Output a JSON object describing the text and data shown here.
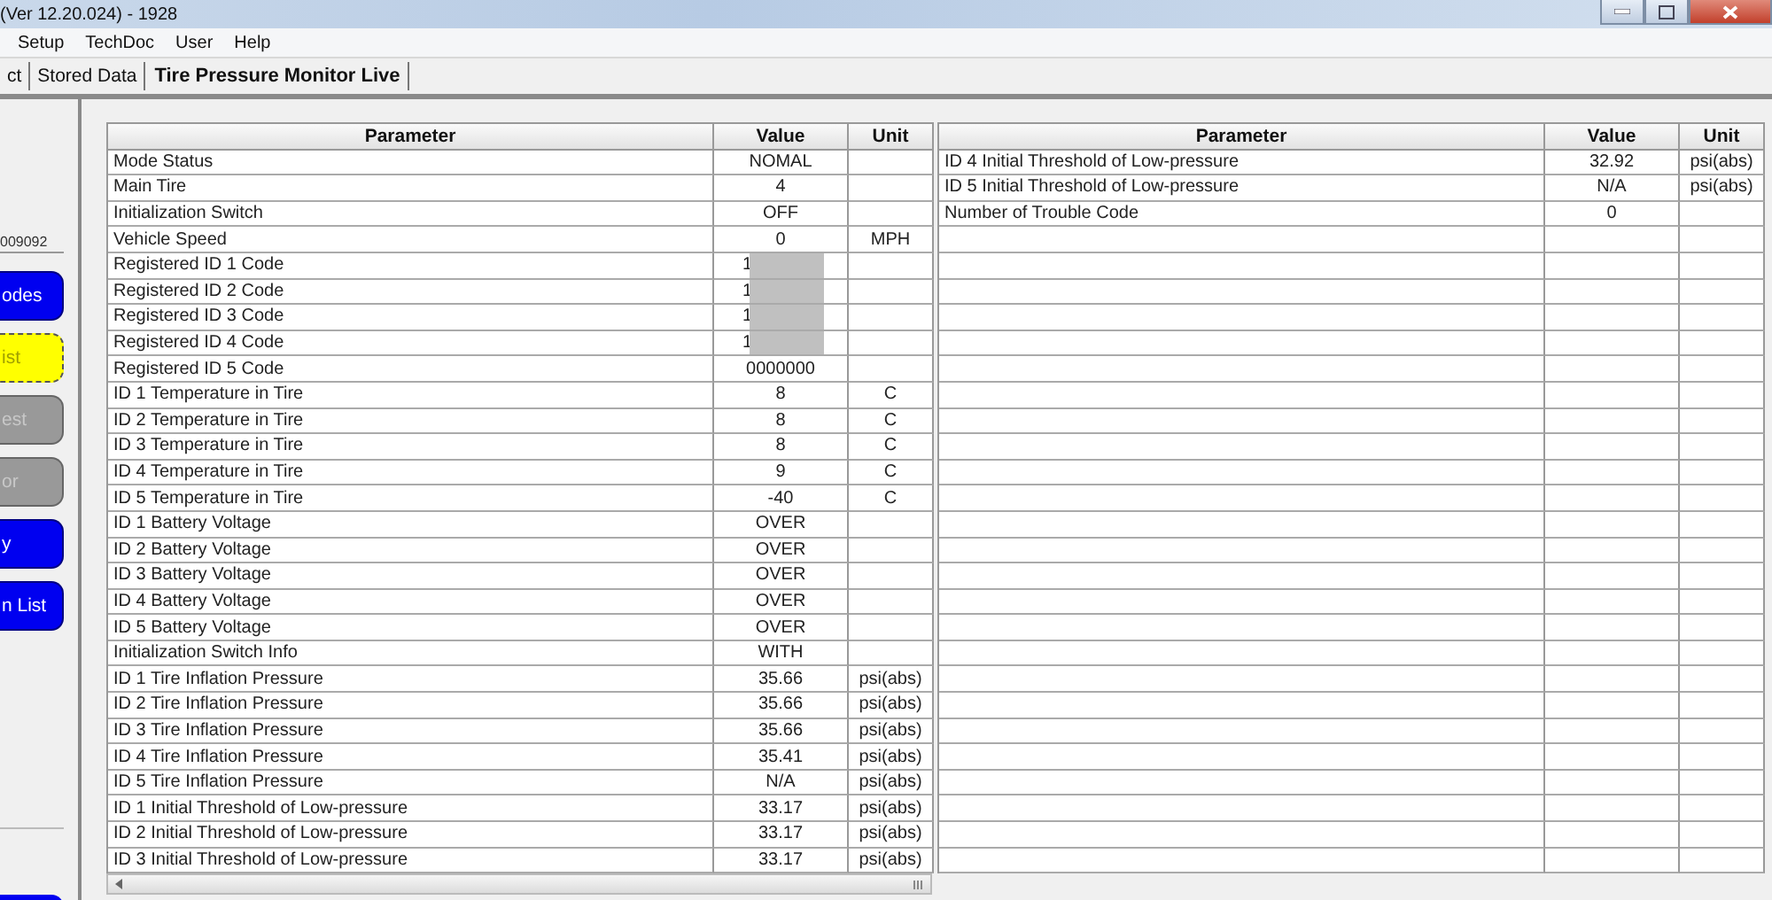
{
  "window": {
    "title": "(Ver 12.20.024) - 1928"
  },
  "menu": [
    "Setup",
    "TechDoc",
    "User",
    "Help"
  ],
  "tabs": [
    {
      "label": "ct",
      "selected": false
    },
    {
      "label": "Stored Data",
      "selected": false
    },
    {
      "label": "Tire Pressure Monitor Live",
      "selected": true
    }
  ],
  "sidebar": {
    "field_value": "009092",
    "buttons": [
      {
        "label": "odes",
        "kind": "blue"
      },
      {
        "label": "ist",
        "kind": "yellow"
      },
      {
        "label": "est",
        "kind": "disabled"
      },
      {
        "label": "or",
        "kind": "disabled"
      },
      {
        "label": "y",
        "kind": "blue"
      },
      {
        "label": "n List",
        "kind": "blue"
      }
    ]
  },
  "tables": [
    {
      "columns": [
        "Parameter",
        "Value",
        "Unit"
      ],
      "rows": [
        {
          "parameter": "Mode Status",
          "value": "NOMAL",
          "unit": ""
        },
        {
          "parameter": "Main Tire",
          "value": "4",
          "unit": ""
        },
        {
          "parameter": "Initialization Switch",
          "value": "OFF",
          "unit": ""
        },
        {
          "parameter": "Vehicle Speed",
          "value": "0",
          "unit": "MPH"
        },
        {
          "parameter": "Registered ID 1 Code",
          "value": "1",
          "unit": "",
          "redacted": true
        },
        {
          "parameter": "Registered ID 2 Code",
          "value": "1",
          "unit": "",
          "redacted": true
        },
        {
          "parameter": "Registered ID 3 Code",
          "value": "1",
          "unit": "",
          "redacted": true
        },
        {
          "parameter": "Registered ID 4 Code",
          "value": "1",
          "unit": "",
          "redacted": true
        },
        {
          "parameter": "Registered ID 5 Code",
          "value": "0000000",
          "unit": ""
        },
        {
          "parameter": "ID 1 Temperature in Tire",
          "value": "8",
          "unit": "C"
        },
        {
          "parameter": "ID 2 Temperature in Tire",
          "value": "8",
          "unit": "C"
        },
        {
          "parameter": "ID 3 Temperature in Tire",
          "value": "8",
          "unit": "C"
        },
        {
          "parameter": "ID 4 Temperature in Tire",
          "value": "9",
          "unit": "C"
        },
        {
          "parameter": "ID 5 Temperature in Tire",
          "value": "-40",
          "unit": "C"
        },
        {
          "parameter": "ID 1 Battery Voltage",
          "value": "OVER",
          "unit": ""
        },
        {
          "parameter": "ID 2 Battery Voltage",
          "value": "OVER",
          "unit": ""
        },
        {
          "parameter": "ID 3 Battery Voltage",
          "value": "OVER",
          "unit": ""
        },
        {
          "parameter": "ID 4 Battery Voltage",
          "value": "OVER",
          "unit": ""
        },
        {
          "parameter": "ID 5 Battery Voltage",
          "value": "OVER",
          "unit": ""
        },
        {
          "parameter": "Initialization Switch Info",
          "value": "WITH",
          "unit": ""
        },
        {
          "parameter": "ID 1 Tire Inflation Pressure",
          "value": "35.66",
          "unit": "psi(abs)"
        },
        {
          "parameter": "ID 2 Tire Inflation Pressure",
          "value": "35.66",
          "unit": "psi(abs)"
        },
        {
          "parameter": "ID 3 Tire Inflation Pressure",
          "value": "35.66",
          "unit": "psi(abs)"
        },
        {
          "parameter": "ID 4 Tire Inflation Pressure",
          "value": "35.41",
          "unit": "psi(abs)"
        },
        {
          "parameter": "ID 5 Tire Inflation Pressure",
          "value": "N/A",
          "unit": "psi(abs)"
        },
        {
          "parameter": "ID 1 Initial Threshold of Low-pressure",
          "value": "33.17",
          "unit": "psi(abs)"
        },
        {
          "parameter": "ID 2 Initial Threshold of Low-pressure",
          "value": "33.17",
          "unit": "psi(abs)"
        },
        {
          "parameter": "ID 3 Initial Threshold of Low-pressure",
          "value": "33.17",
          "unit": "psi(abs)"
        }
      ]
    },
    {
      "columns": [
        "Parameter",
        "Value",
        "Unit"
      ],
      "rows": [
        {
          "parameter": "ID 4 Initial Threshold of Low-pressure",
          "value": "32.92",
          "unit": "psi(abs)"
        },
        {
          "parameter": "ID 5 Initial Threshold of Low-pressure",
          "value": "N/A",
          "unit": "psi(abs)"
        },
        {
          "parameter": "Number of Trouble Code",
          "value": "0",
          "unit": ""
        }
      ]
    }
  ]
}
